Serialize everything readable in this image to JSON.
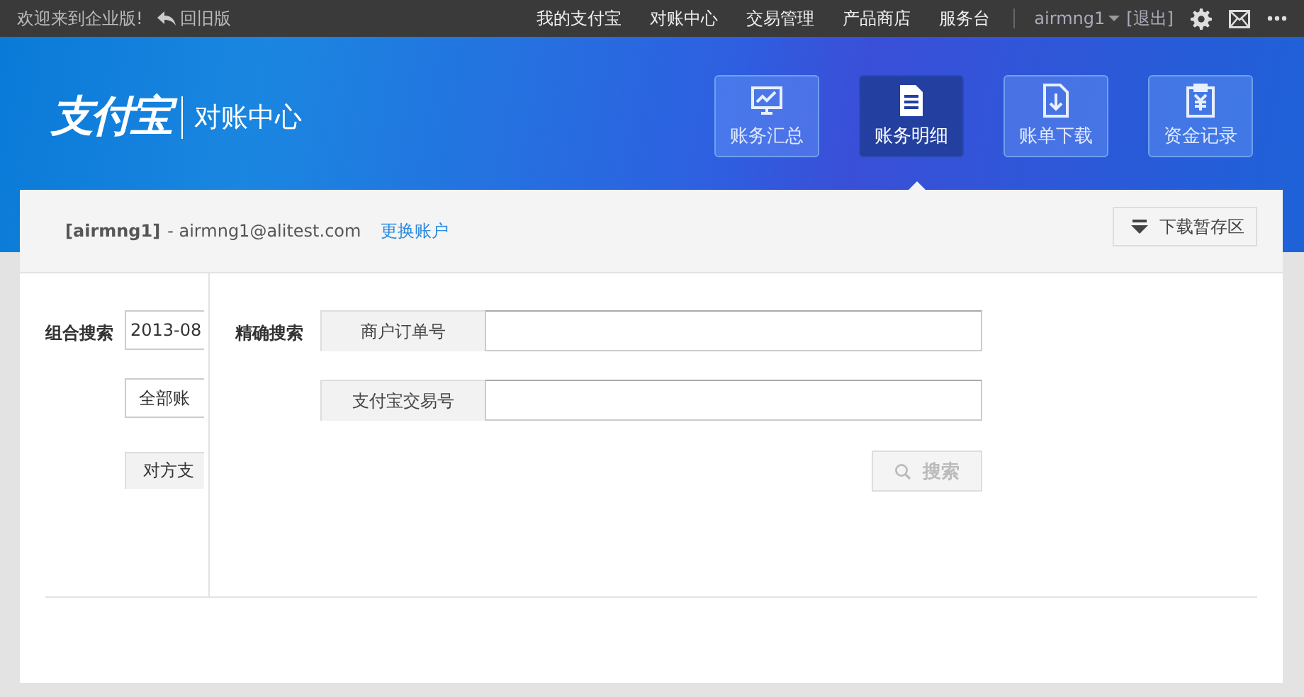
{
  "topbar": {
    "welcome": "欢迎来到企业版!",
    "back": "回旧版",
    "nav": [
      "我的支付宝",
      "对账中心",
      "交易管理",
      "产品商店",
      "服务台"
    ],
    "user": "airmng1",
    "logout": "[退出]"
  },
  "header": {
    "logo": "支付宝",
    "title": "对账中心",
    "tabs": [
      {
        "label": "账务汇总",
        "kind": "chart",
        "selected": false
      },
      {
        "label": "账务明细",
        "kind": "doc",
        "selected": true
      },
      {
        "label": "账单下载",
        "kind": "download",
        "selected": false
      },
      {
        "label": "资金记录",
        "kind": "money",
        "selected": false
      }
    ]
  },
  "account": {
    "name": "[airmng1]",
    "email": "- airmng1@alitest.com",
    "switch": "更换账户",
    "download_area": "下载暂存区"
  },
  "combo": {
    "label": "组合搜索",
    "fields": [
      {
        "kind": "input",
        "value": "2013-08"
      },
      {
        "kind": "select",
        "value": "全部账"
      },
      {
        "kind": "labeled",
        "value": "对方支"
      }
    ]
  },
  "exact": {
    "label": "精确搜索",
    "fields": [
      {
        "label": "商户订单号"
      },
      {
        "label": "支付宝交易号"
      }
    ],
    "search": {
      "label": "搜索",
      "disabled": true
    }
  }
}
